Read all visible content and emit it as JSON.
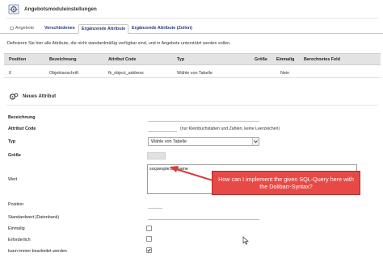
{
  "header": {
    "title": "Angebotsmoduleinstellungen",
    "icon": "settings-gear-icon"
  },
  "tabs": [
    {
      "label": "Angebote"
    },
    {
      "label": "Verschiedenes"
    },
    {
      "label": "Ergänzende Attribute"
    },
    {
      "label": "Ergänzende Attribute (Zeilen)"
    }
  ],
  "active_tab": "Ergänzende Attribute",
  "intro": "Definieren Sie hier alle Attribute, die nicht standardmäßig verfügbar sind, und in Angebote unterstützt werden sollen.",
  "table": {
    "columns": [
      "Position",
      "Bezeichnung",
      "Attribut Code",
      "Typ",
      "Größe",
      "Einmalig",
      "Berechnetes Feld"
    ],
    "rows": [
      [
        "0",
        "Objektanschrift",
        "fk_object_address",
        "Wähle von Tabelle",
        "",
        "Nein",
        ""
      ]
    ]
  },
  "section": {
    "title": "Neues Attribut",
    "icon": "gear-icon"
  },
  "form": {
    "bezeichnung_label": "Bezeichnung",
    "attribut_code_label": "Attribut Code",
    "attribut_code_hint": "(nur Kleinbuchstaben und Zahlen, keine Leerzeichen)",
    "typ_label": "Typ",
    "typ_value": "Wähle von Tabelle",
    "groesse_label": "Größe",
    "wert_label": "Wert",
    "wert_value": "socpeople:lastname",
    "position_label": "Position",
    "standardwert_label": "Standardwert (Datenbank)",
    "einmalig_label": "Einmalig",
    "erforderlich_label": "Erforderlich",
    "bearbeitet_label": "kann immer bearbeitet werden",
    "einmalig_checked": false,
    "erforderlich_checked": false,
    "bearbeitet_checked": true
  },
  "annotation": {
    "text": "How can I implement the given SQL-Query here with the Dolibarr-Syntax?",
    "color": "#e74a46"
  }
}
